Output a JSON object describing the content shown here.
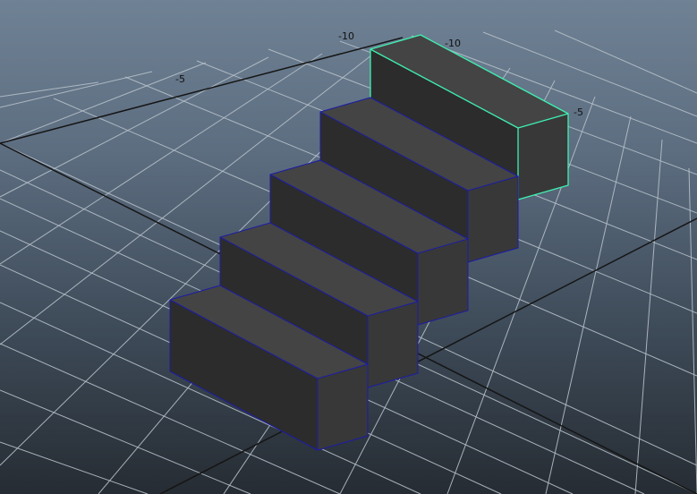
{
  "viewport": {
    "background_top": "#6f8194",
    "background_bottom": "#262c33",
    "grid_color": "#b6c0c9",
    "axis_color": "#151515"
  },
  "grid_labels": {
    "x_neg10": "-10",
    "z_neg10": "-10",
    "x_neg5": "-5",
    "z_neg5": "-5"
  },
  "objects": {
    "step_count": 5,
    "selected_step": "step-5",
    "wireframe_color": "#1c1ca6",
    "selection_color": "#3ff0b0",
    "shaded_colors": {
      "front": "#2c2c2c",
      "top": "#444444",
      "side": "#383838"
    }
  }
}
